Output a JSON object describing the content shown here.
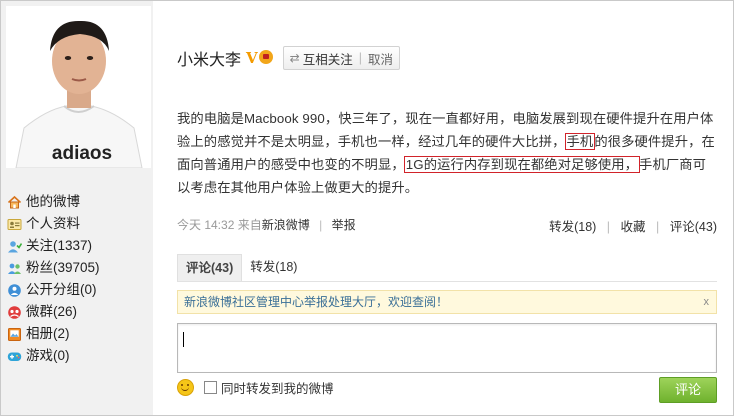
{
  "profile": {
    "username": "小米大李",
    "verified_badge": "V",
    "follow_status": "互相关注",
    "cancel_label": "取消"
  },
  "sidebar": {
    "items": [
      {
        "label": "他的微博",
        "icon": "home-icon"
      },
      {
        "label": "个人资料",
        "icon": "profile-card-icon"
      },
      {
        "label": "关注(1337)",
        "icon": "following-icon"
      },
      {
        "label": "粉丝(39705)",
        "icon": "fans-icon"
      },
      {
        "label": "公开分组(0)",
        "icon": "groups-icon"
      },
      {
        "label": "微群(26)",
        "icon": "weiqun-icon"
      },
      {
        "label": "相册(2)",
        "icon": "album-icon"
      },
      {
        "label": "游戏(0)",
        "icon": "game-icon"
      }
    ]
  },
  "avatar_tshirt_text": "adiaos",
  "post": {
    "text_1": "我的电脑是Macbook 990，快三年了，现在一直都好用，电脑发展到现在硬件提升在用户体验上的感觉并不是太明显，手机也一样，经过几年的硬件大比拼，",
    "highlight_1": "手机",
    "text_2": "的很多硬件提升，在面向普通用户的感受中也变的不明显，",
    "highlight_2": "1G的运行内存到现在都绝对足够使用，",
    "text_3": "手机厂商可以考虑在其他用户体验上做更大的提升。",
    "time": "今天 14:32",
    "source_prefix": "来自",
    "source": "新浪微博",
    "report": "举报",
    "repost_label": "转发(18)",
    "favorite_label": "收藏",
    "comment_label": "评论(43)"
  },
  "tabs": {
    "comments": "评论(43)",
    "reposts": "转发(18)"
  },
  "notice": {
    "text": "新浪微博社区管理中心举报处理大厅，欢迎查阅！",
    "close": "x"
  },
  "comment_box": {
    "placeholder": "",
    "also_repost_label": "同时转发到我的微博",
    "submit_label": "评论"
  },
  "colors": {
    "highlight_border": "#d1232a",
    "submit_button": "#7dc13c",
    "notice_text": "#3a6f97",
    "sidebar_bg": "#f1f1f1"
  }
}
